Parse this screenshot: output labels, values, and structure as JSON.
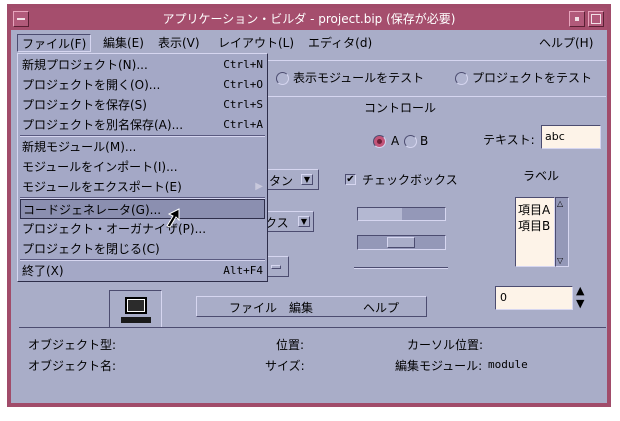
{
  "window": {
    "title": "アプリケーション・ビルダ - project.bip (保存が必要)"
  },
  "menubar": {
    "file": "ファイル(F)",
    "edit": "編集(E)",
    "view": "表示(V)",
    "layout": "レイアウト(L)",
    "editor": "エディタ(d)",
    "help": "ヘルプ(H)"
  },
  "file_menu": {
    "items": [
      {
        "label": "新規プロジェクト(N)...",
        "accel": "Ctrl+N"
      },
      {
        "label": "プロジェクトを開く(O)...",
        "accel": "Ctrl+O"
      },
      {
        "label": "プロジェクトを保存(S)",
        "accel": "Ctrl+S"
      },
      {
        "label": "プロジェクトを別名保存(A)...",
        "accel": "Ctrl+A"
      },
      {
        "label": "新規モジュール(M)...",
        "accel": ""
      },
      {
        "label": "モジュールをインポート(I)...",
        "accel": ""
      },
      {
        "label": "モジュールをエクスポート(E)",
        "accel": ""
      },
      {
        "label": "コードジェネレータ(G)...",
        "accel": ""
      },
      {
        "label": "プロジェクト・オーガナイザ(P)...",
        "accel": ""
      },
      {
        "label": "プロジェクトを閉じる(C)",
        "accel": ""
      },
      {
        "label": "終了(X)",
        "accel": "Alt+F4"
      }
    ]
  },
  "toolbar": {
    "test_module": "表示モジュールをテスト",
    "test_project": "プロジェクトをテスト"
  },
  "canvas": {
    "controls_label": "コントロール",
    "radio_a": "A",
    "radio_b": "B",
    "text_label": "テキスト:",
    "text_value": "abc",
    "button_fragment": "タン",
    "combo_fragment": "クス",
    "checkbox_label": "チェックボックス",
    "checkbox_checked": true,
    "label_label": "ラベル",
    "list_items": [
      "項目A",
      "項目B"
    ],
    "spin_value": "0",
    "mini_menubar": [
      "ファイル",
      "編集",
      "ヘルプ"
    ]
  },
  "info": {
    "object_type_label": "オブジェクト型:",
    "position_label": "位置:",
    "cursor_position_label": "カーソル位置:",
    "object_name_label": "オブジェクト名:",
    "size_label": "サイズ:",
    "edit_module_label": "編集モジュール:",
    "edit_module_value": "module"
  },
  "colors": {
    "title_bar": "#a54e6d",
    "client_bg": "#a9adc8",
    "field_bg": "#fdf3e8",
    "radio_on": "#c25478"
  }
}
